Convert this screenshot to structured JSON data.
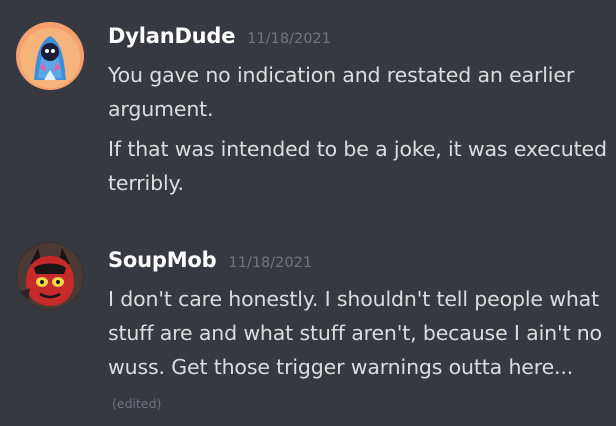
{
  "messages": [
    {
      "username": "DylanDude",
      "timestamp": "11/18/2021",
      "avatar_icon": "blue-hooded-character-avatar",
      "lines": [
        "You gave no indication and restated an earlier argument.",
        "If that was intended to be a joke, it was executed terribly."
      ]
    },
    {
      "username": "SoupMob",
      "timestamp": "11/18/2021",
      "avatar_icon": "red-horned-character-avatar",
      "lines": [
        "I don't care honestly. I shouldn't tell people what stuff are and what stuff aren't, because I ain't no wuss. Get those trigger warnings outta here..."
      ],
      "edited_label": "(edited)"
    }
  ],
  "colors": {
    "background": "#36393f",
    "username": "#ffffff",
    "text": "#dcddde",
    "muted": "#72767d"
  }
}
